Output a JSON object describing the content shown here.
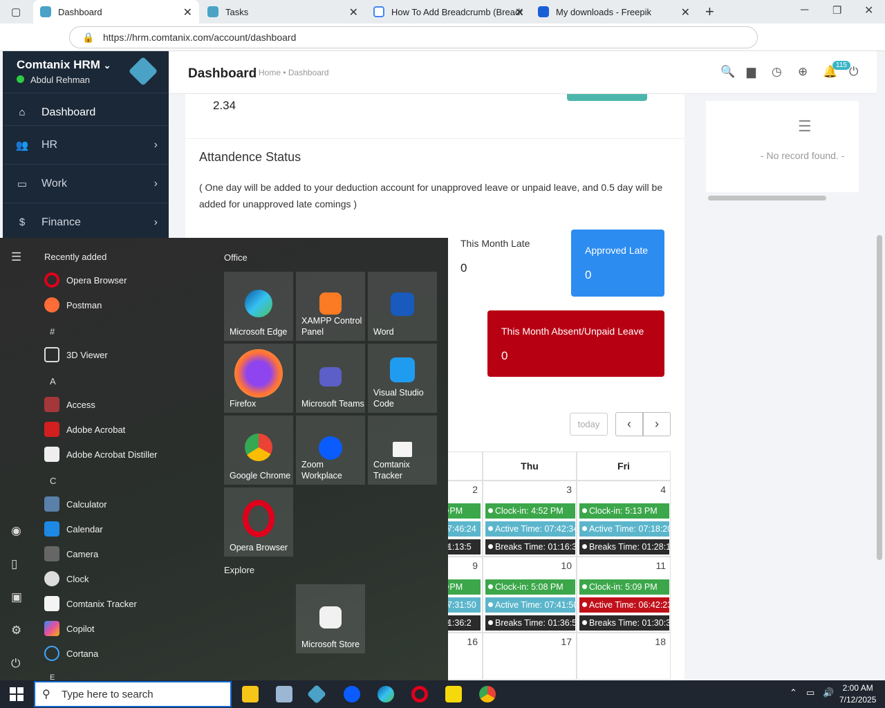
{
  "browser": {
    "tabs": [
      {
        "label": "Dashboard"
      },
      {
        "label": "Tasks"
      },
      {
        "label": "How To Add Breadcrumb (Breadc"
      },
      {
        "label": "My downloads - Freepik"
      }
    ],
    "url": "https://hrm.comtanix.com/account/dashboard"
  },
  "app": {
    "name": "Comtanix HRM",
    "user": "Abdul Rehman",
    "nav": [
      {
        "label": "Dashboard",
        "icon": "home-icon"
      },
      {
        "label": "HR",
        "icon": "users-icon"
      },
      {
        "label": "Work",
        "icon": "briefcase-icon"
      },
      {
        "label": "Finance",
        "icon": "dollar-icon"
      }
    ],
    "page_title": "Dashboard",
    "breadcrumb": "Home • Dashboard",
    "notification_count": "115"
  },
  "dashboard": {
    "partial_value": "2.34",
    "attendance_title": "Attandence Status",
    "attendance_note": "( One day will be added to your deduction account for unapproved leave or unpaid leave, and 0.5 day will be added for unapproved late comings )",
    "month_late_label": "This Month Late",
    "month_late_value": "0",
    "approved_late_label": "Approved Late",
    "approved_late_value": "0",
    "absent_label": "This Month Absent/Unpaid Leave",
    "absent_value": "0",
    "today_label": "today",
    "no_record": "- No record found. -"
  },
  "calendar": {
    "headers": [
      "Thu",
      "Fri"
    ],
    "partial_days": [
      "2",
      "9",
      "16"
    ],
    "days": [
      "3",
      "4",
      "10",
      "11",
      "17",
      "18"
    ],
    "partial_events": [
      "7 PM",
      "07:46:24",
      "01:13:5",
      "3 PM",
      "07:31:50",
      "01:36:2"
    ],
    "events": [
      {
        "text": "Clock-in: 4:52 PM",
        "color": "green"
      },
      {
        "text": "Active Time: 07:42:34",
        "color": "blue"
      },
      {
        "text": "Breaks Time: 01:16:3",
        "color": "dark"
      },
      {
        "text": "Clock-in: 5:13 PM",
        "color": "green"
      },
      {
        "text": "Active Time: 07:18:20",
        "color": "blue"
      },
      {
        "text": "Breaks Time: 01:28:1",
        "color": "dark"
      },
      {
        "text": "Clock-in: 5:08 PM",
        "color": "green"
      },
      {
        "text": "Active Time: 07:41:50",
        "color": "blue"
      },
      {
        "text": "Breaks Time: 01:36:5",
        "color": "dark"
      },
      {
        "text": "Clock-in: 5:09 PM",
        "color": "green"
      },
      {
        "text": "Active Time: 06:42:23",
        "color": "red"
      },
      {
        "text": "Breaks Time: 01:30:3",
        "color": "dark"
      }
    ]
  },
  "start_menu": {
    "recently_added": "Recently added",
    "apps": [
      "Opera Browser",
      "Postman",
      "3D Viewer",
      "Access",
      "Adobe Acrobat",
      "Adobe Acrobat Distiller",
      "Calculator",
      "Calendar",
      "Camera",
      "Clock",
      "Comtanix Tracker",
      "Copilot",
      "Cortana"
    ],
    "sections": [
      "#",
      "A",
      "C",
      "E"
    ],
    "office_label": "Office",
    "explore_label": "Explore",
    "tiles": [
      "Microsoft Edge",
      "XAMPP Control Panel",
      "Word",
      "Firefox",
      "Microsoft Teams",
      "Visual Studio Code",
      "Google Chrome",
      "Zoom Workplace",
      "Comtanix Tracker",
      "Opera Browser",
      "Microsoft Store"
    ]
  },
  "taskbar": {
    "search_placeholder": "Type here to search",
    "time": "2:00 AM",
    "date": "7/12/2025"
  },
  "colors": {
    "sidebar": "#1b2838",
    "approved": "#2d8cf0",
    "absent": "#b80013",
    "clockin": "#3ca74a",
    "active": "#5bb6cc"
  }
}
